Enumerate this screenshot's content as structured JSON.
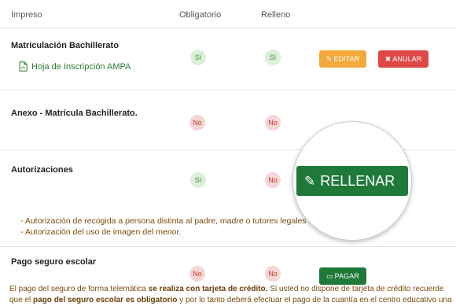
{
  "header": {
    "col_document": "Impreso",
    "col_required": "Obligatorio",
    "col_filled": "Relleno"
  },
  "rows": [
    {
      "title": "Matriculación Bachillerato",
      "link": "Hoja de Inscripción AMPA",
      "required": "Sí",
      "filled": "Sí",
      "edit_label": "EDITAR",
      "cancel_label": "ANULAR"
    },
    {
      "title": "Anexo - Matrícula Bachillerato.",
      "required": "No",
      "filled": "No"
    },
    {
      "title": "Autorizaciones",
      "required": "Sí",
      "filled": "No",
      "fill_label": "RELLENAR",
      "notes": [
        "- Autorización de recogida a persona distinta al padre, madre o tutores legales del a",
        "- Autorización del uso de imagen del menor."
      ]
    },
    {
      "title": "Pago seguro escolar",
      "required": "No",
      "filled": "No",
      "pay_label": "PAGAR",
      "text_1": "El pago del seguro de forma telemática ",
      "text_1_bold": "se realiza con tarjeta de crédito.",
      "text_2": " Si usted no dispone de tarjeta de crédito recuerde",
      "text_3": "que el ",
      "text_3_bold": "pago del seguro escolar es obligatorio",
      "text_4": " y por lo tanto deberá efectuar el pago de la cuantía en el centro educativo una"
    }
  ],
  "colors": {
    "green": "#1f7a3a",
    "orange": "#f4a93b",
    "red": "#e04848",
    "note_brown": "#7a4b0b"
  },
  "icons": {
    "document": "document-icon",
    "pencil": "pencil-icon",
    "close": "close-icon",
    "card": "credit-card-icon"
  }
}
